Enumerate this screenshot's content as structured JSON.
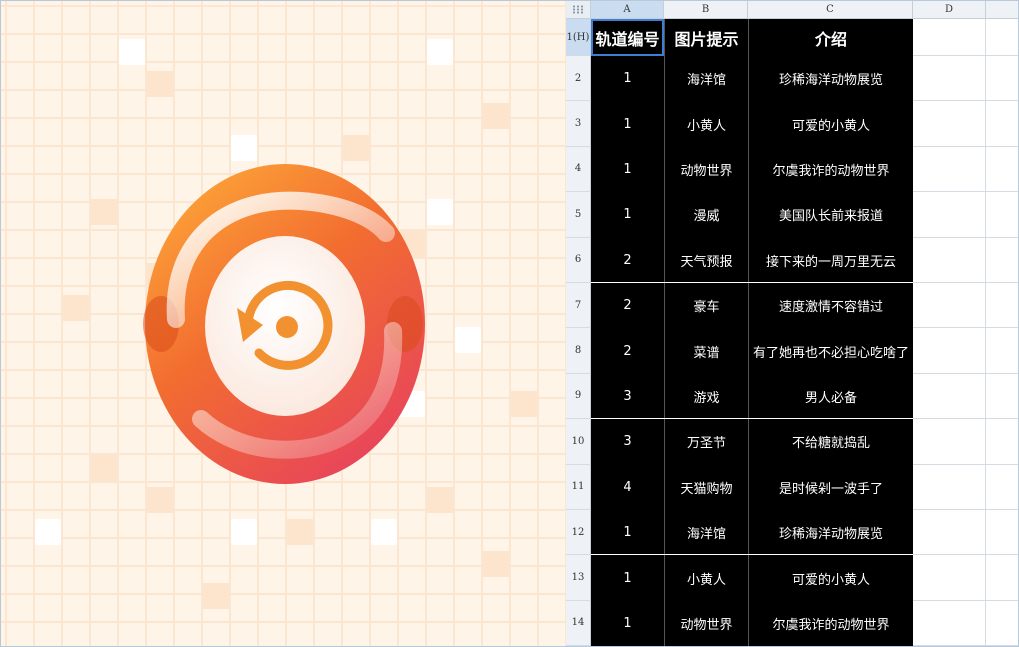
{
  "sheet": {
    "columns": [
      "A",
      "B",
      "C",
      "D"
    ],
    "header_row_label": "1(H)",
    "headers": [
      "轨道编号",
      "图片提示",
      "介绍"
    ],
    "rows": [
      {
        "n": "2",
        "track": "1",
        "hint": "海洋馆",
        "intro": "珍稀海洋动物展览"
      },
      {
        "n": "3",
        "track": "1",
        "hint": "小黄人",
        "intro": "可爱的小黄人"
      },
      {
        "n": "4",
        "track": "1",
        "hint": "动物世界",
        "intro": "尔虞我诈的动物世界"
      },
      {
        "n": "5",
        "track": "1",
        "hint": "漫威",
        "intro": "美国队长前来报道"
      },
      {
        "n": "6",
        "track": "2",
        "hint": "天气预报",
        "intro": "接下来的一周万里无云"
      },
      {
        "n": "7",
        "track": "2",
        "hint": "豪车",
        "intro": "速度激情不容错过"
      },
      {
        "n": "8",
        "track": "2",
        "hint": "菜谱",
        "intro": "有了她再也不必担心吃啥了"
      },
      {
        "n": "9",
        "track": "3",
        "hint": "游戏",
        "intro": "男人必备"
      },
      {
        "n": "10",
        "track": "3",
        "hint": "万圣节",
        "intro": "不给糖就捣乱"
      },
      {
        "n": "11",
        "track": "4",
        "hint": "天猫购物",
        "intro": "是时候剁一波手了"
      },
      {
        "n": "12",
        "track": "1",
        "hint": "海洋馆",
        "intro": "珍稀海洋动物展览"
      },
      {
        "n": "13",
        "track": "1",
        "hint": "小黄人",
        "intro": "可爱的小黄人"
      },
      {
        "n": "14",
        "track": "1",
        "hint": "动物世界",
        "intro": "尔虞我诈的动物世界"
      }
    ]
  },
  "image_panel": {
    "icon": "refresh-rotate-logo-icon",
    "colors": {
      "background": "#fff4e8",
      "ring_top": "#ffb03a",
      "ring_bottom": "#e8455a",
      "inner_icon": "#f29130"
    }
  },
  "colors": {
    "sheet_bg": "#000000",
    "sheet_text": "#ffffff",
    "selection": "#3d7fd0",
    "header_bg": "#eef2f6"
  }
}
